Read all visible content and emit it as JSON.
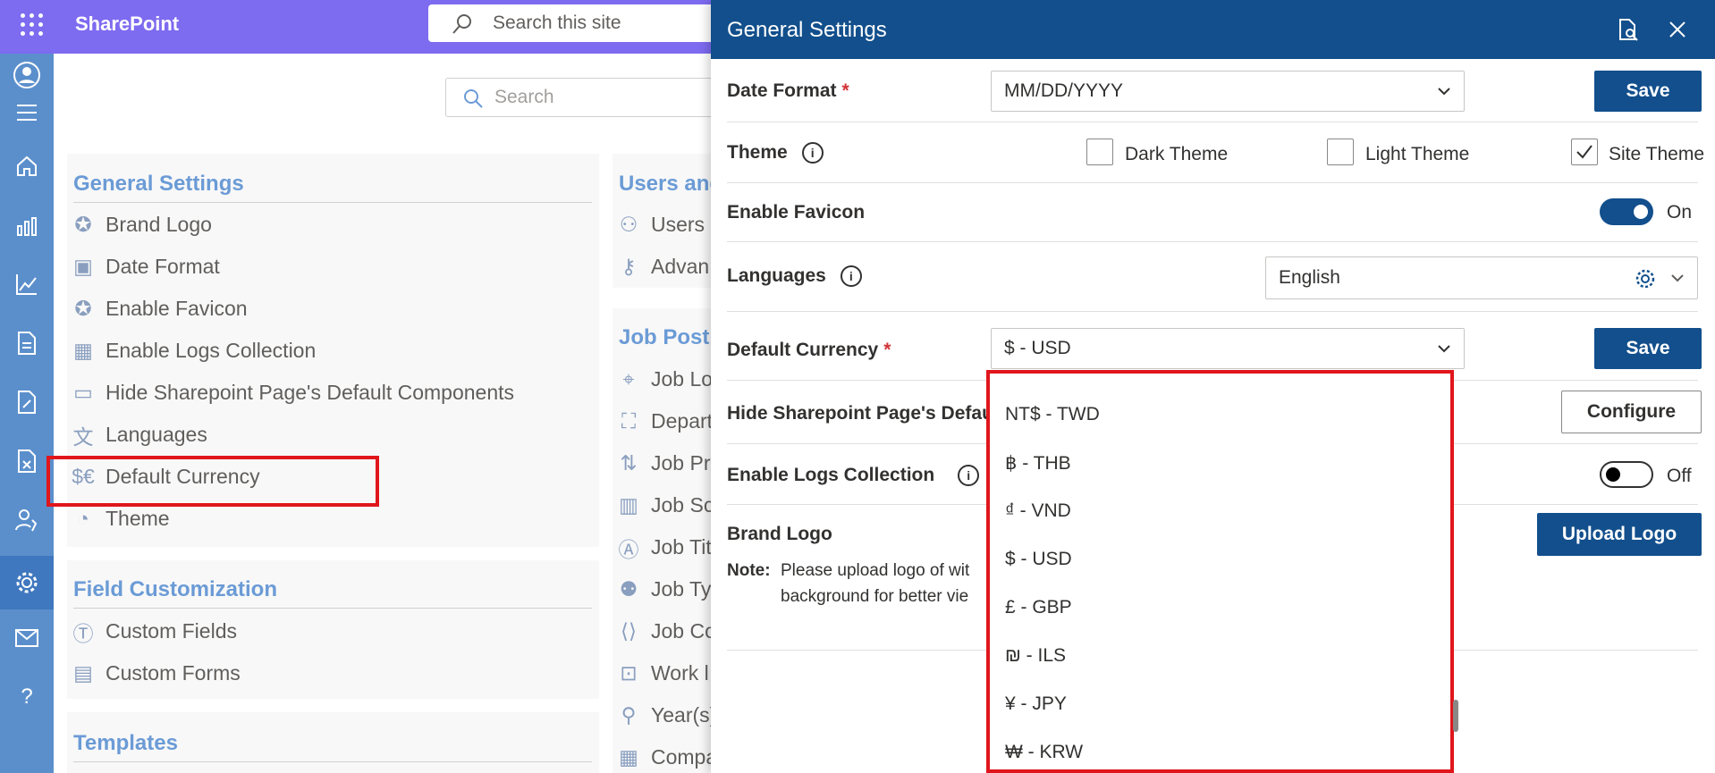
{
  "app": {
    "name": "SharePoint",
    "search_placeholder": "Search this site"
  },
  "page": {
    "search_placeholder": "Search"
  },
  "sections": {
    "general": {
      "title": "General Settings",
      "items": [
        "Brand Logo",
        "Date Format",
        "Enable Favicon",
        "Enable Logs Collection",
        "Hide Sharepoint Page's Default Components",
        "Languages",
        "Default Currency",
        "Theme"
      ]
    },
    "field": {
      "title": "Field Customization",
      "items": [
        "Custom Fields",
        "Custom Forms"
      ]
    },
    "templates": {
      "title": "Templates"
    },
    "users": {
      "title": "Users and",
      "items": [
        "Users",
        "Advan"
      ]
    },
    "jobs": {
      "title": "Job Postin",
      "items": [
        "Job Lo",
        "Depart",
        "Job Pr",
        "Job Sc",
        "Job Tit",
        "Job Ty",
        "Job Co",
        "Work l",
        "Year(s)",
        "Compa"
      ]
    }
  },
  "panel": {
    "title": "General Settings",
    "date_format": {
      "label": "Date Format",
      "required": "*",
      "value": "MM/DD/YYYY",
      "save": "Save"
    },
    "theme": {
      "label": "Theme",
      "info": "i",
      "options": [
        "Dark Theme",
        "Light Theme",
        "Site Theme"
      ],
      "checked": "Site Theme"
    },
    "favicon": {
      "label": "Enable Favicon",
      "state": "On"
    },
    "languages": {
      "label": "Languages",
      "info": "i",
      "value": "English"
    },
    "currency": {
      "label": "Default Currency",
      "required": "*",
      "value": "$ - USD",
      "save": "Save",
      "options": [
        "NT$ - TWD",
        "฿ - THB",
        "₫ - VND",
        "$ - USD",
        "£ - GBP",
        "₪ - ILS",
        "¥ - JPY",
        "₩ - KRW"
      ]
    },
    "hide_components": {
      "label": "Hide Sharepoint Page's Default",
      "button": "Configure"
    },
    "logs": {
      "label": "Enable Logs Collection",
      "info": "i",
      "state": "Off"
    },
    "brand_logo": {
      "label": "Brand Logo",
      "button": "Upload Logo",
      "note_label": "Note:",
      "note_line1": "Please upload logo of wit",
      "note_line2": "background for better vie"
    }
  },
  "colors": {
    "suite_bar": "#7d6bf0",
    "panel_header": "#124f8c",
    "rail": "#5b8fcc",
    "highlight": "#e0161c",
    "section_title": "#6b9bd6"
  }
}
